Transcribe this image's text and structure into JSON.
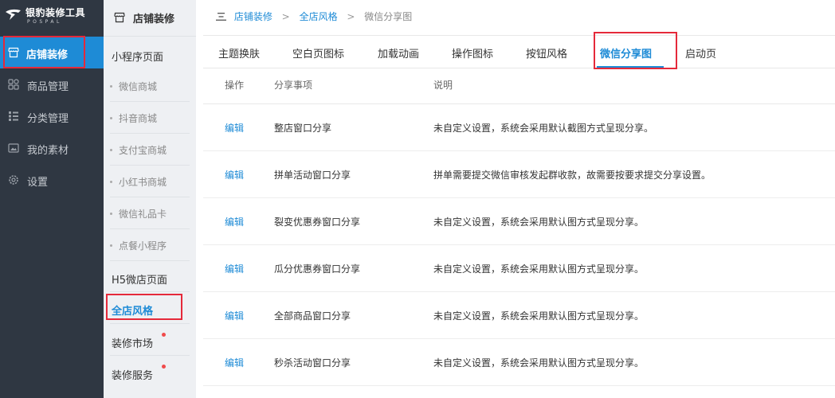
{
  "logo": {
    "name": "银豹装修工具",
    "sub": "POSPAL"
  },
  "sidebar": {
    "items": [
      {
        "label": "店铺装修",
        "icon": "store-icon"
      },
      {
        "label": "商品管理",
        "icon": "grid-icon"
      },
      {
        "label": "分类管理",
        "icon": "list-icon"
      },
      {
        "label": "我的素材",
        "icon": "image-icon"
      },
      {
        "label": "设置",
        "icon": "gear-icon"
      }
    ]
  },
  "submenu": {
    "title": "店铺装修",
    "group_miniprogram": "小程序页面",
    "items": [
      "微信商城",
      "抖音商城",
      "支付宝商城",
      "小红书商城",
      "微信礼品卡",
      "点餐小程序"
    ],
    "group_h5": "H5微店页面",
    "group_style": "全店风格",
    "market": "装修市场",
    "service": "装修服务"
  },
  "breadcrumb": {
    "first": "店铺装修",
    "second": "全店风格",
    "current": "微信分享图",
    "sep": ">"
  },
  "tabs": [
    "主题换肤",
    "空白页图标",
    "加载动画",
    "操作图标",
    "按钮风格",
    "微信分享图",
    "启动页"
  ],
  "table": {
    "headers": {
      "op": "操作",
      "item": "分享事项",
      "desc": "说明"
    },
    "edit_label": "编辑",
    "rows": [
      {
        "item": "整店窗口分享",
        "desc": "未自定义设置，系统会采用默认截图方式呈现分享。"
      },
      {
        "item": "拼单活动窗口分享",
        "desc": "拼单需要提交微信审核发起群收款，故需要按要求提交分享设置。"
      },
      {
        "item": "裂变优惠券窗口分享",
        "desc": "未自定义设置，系统会采用默认图方式呈现分享。"
      },
      {
        "item": "瓜分优惠券窗口分享",
        "desc": "未自定义设置，系统会采用默认图方式呈现分享。"
      },
      {
        "item": "全部商品窗口分享",
        "desc": "未自定义设置，系统会采用默认图方式呈现分享。"
      },
      {
        "item": "秒杀活动窗口分享",
        "desc": "未自定义设置，系统会采用默认图方式呈现分享。"
      }
    ]
  },
  "colors": {
    "accent": "#1e8bd6",
    "sidebar_bg": "#2f3742",
    "submenu_bg": "#eef0f3",
    "highlight": "#e5293a",
    "badge": "#f04b4b"
  }
}
